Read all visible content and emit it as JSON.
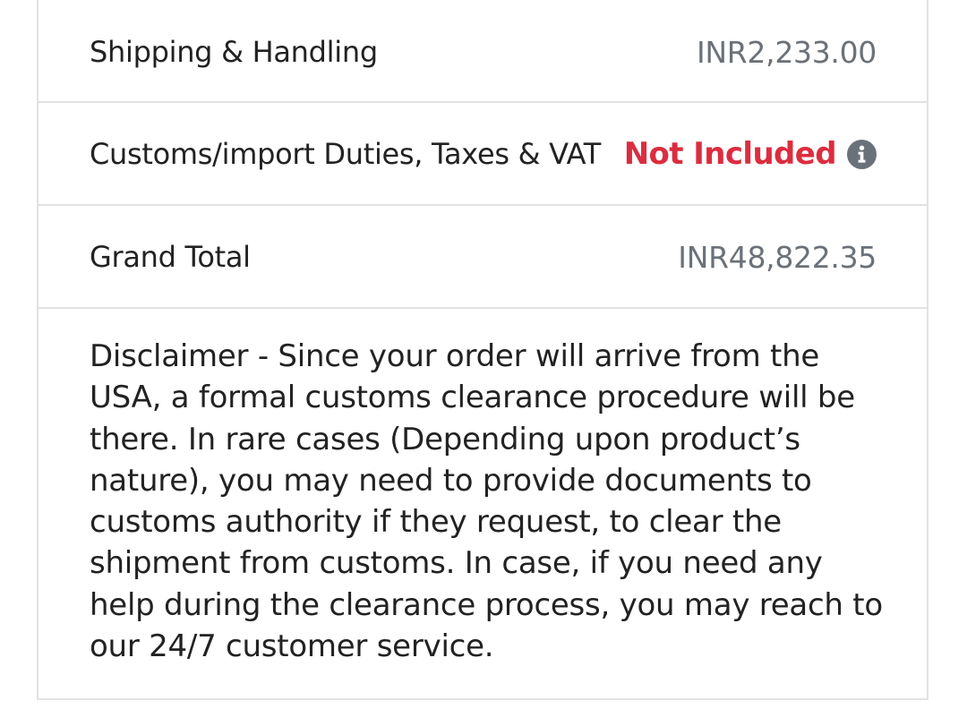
{
  "summary": {
    "shipping": {
      "label": "Shipping & Handling",
      "value": "INR2,233.00"
    },
    "duties": {
      "label": "Customs/import Duties, Taxes & VAT",
      "value": "Not Included",
      "value_color": "#dc2d3f",
      "icon": "info-icon"
    },
    "grand_total": {
      "label": "Grand Total",
      "value": "INR48,822.35"
    }
  },
  "disclaimer": {
    "text": "Disclaimer - Since your order will arrive from the USA, a formal customs clearance procedure will be there. In rare cases (Depending upon product’s nature), you may need to provide documents to customs authority if they request, to clear the shipment from customs. In case, if you need any help during the clearance process, you may reach to our 24/7 customer service."
  }
}
